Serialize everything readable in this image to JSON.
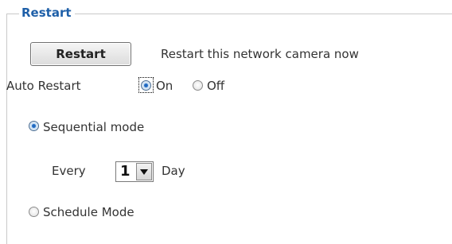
{
  "group": {
    "title": "Restart"
  },
  "restart": {
    "button_label": "Restart",
    "description": "Restart this network camera now"
  },
  "auto_restart": {
    "label": "Auto Restart",
    "options": [
      {
        "label": "On",
        "selected": true
      },
      {
        "label": "Off",
        "selected": false
      }
    ]
  },
  "modes": {
    "sequential": {
      "label": "Sequential mode",
      "selected": true
    },
    "every": {
      "prefix": "Every",
      "value": "1",
      "unit": "Day"
    },
    "schedule": {
      "label": "Schedule Mode",
      "selected": false
    }
  },
  "colors": {
    "legend": "#1e5fa8",
    "radio_checked": "#1c5aa8"
  },
  "icons": {
    "dropdown": "chevron-down-icon",
    "radio_on": "radio-checked-icon",
    "radio_off": "radio-unchecked-icon"
  }
}
